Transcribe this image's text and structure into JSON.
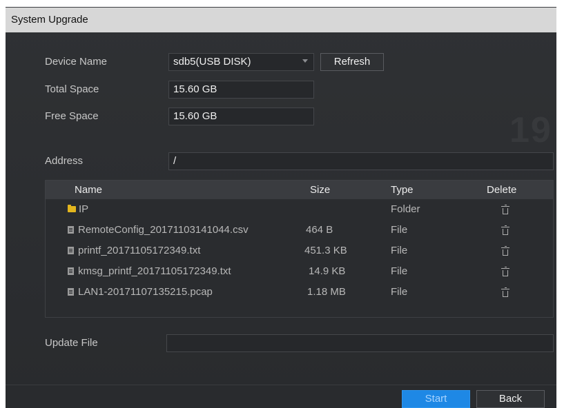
{
  "dialog": {
    "title": "System Upgrade"
  },
  "device": {
    "name_label": "Device Name",
    "name_value": "sdb5(USB DISK)",
    "refresh_label": "Refresh",
    "total_label": "Total Space",
    "total_value": "15.60 GB",
    "free_label": "Free Space",
    "free_value": "15.60 GB",
    "address_label": "Address",
    "address_value": "/"
  },
  "table": {
    "headers": {
      "name": "Name",
      "size": "Size",
      "type": "Type",
      "delete": "Delete"
    },
    "rows": [
      {
        "name": "IP",
        "size": "",
        "type": "Folder",
        "icon": "folder-icon",
        "deletable": true
      },
      {
        "name": "RemoteConfig_20171103141044.csv",
        "size": "464 B",
        "type": "File",
        "icon": "file-icon",
        "deletable": true
      },
      {
        "name": "printf_20171105172349.txt",
        "size": "451.3 KB",
        "type": "File",
        "icon": "file-icon",
        "deletable": true
      },
      {
        "name": "kmsg_printf_20171105172349.txt",
        "size": "14.9 KB",
        "type": "File",
        "icon": "file-icon",
        "deletable": true
      },
      {
        "name": "LAN1-20171107135215.pcap",
        "size": "1.18 MB",
        "type": "File",
        "icon": "file-icon",
        "deletable": true
      }
    ]
  },
  "update": {
    "label": "Update File",
    "value": ""
  },
  "footer": {
    "start_label": "Start",
    "back_label": "Back"
  },
  "colors": {
    "accent": "#1e88e5",
    "folder": "#e3b61e",
    "titlebar": "#d7d7d7",
    "panel": "#2b2d30"
  }
}
